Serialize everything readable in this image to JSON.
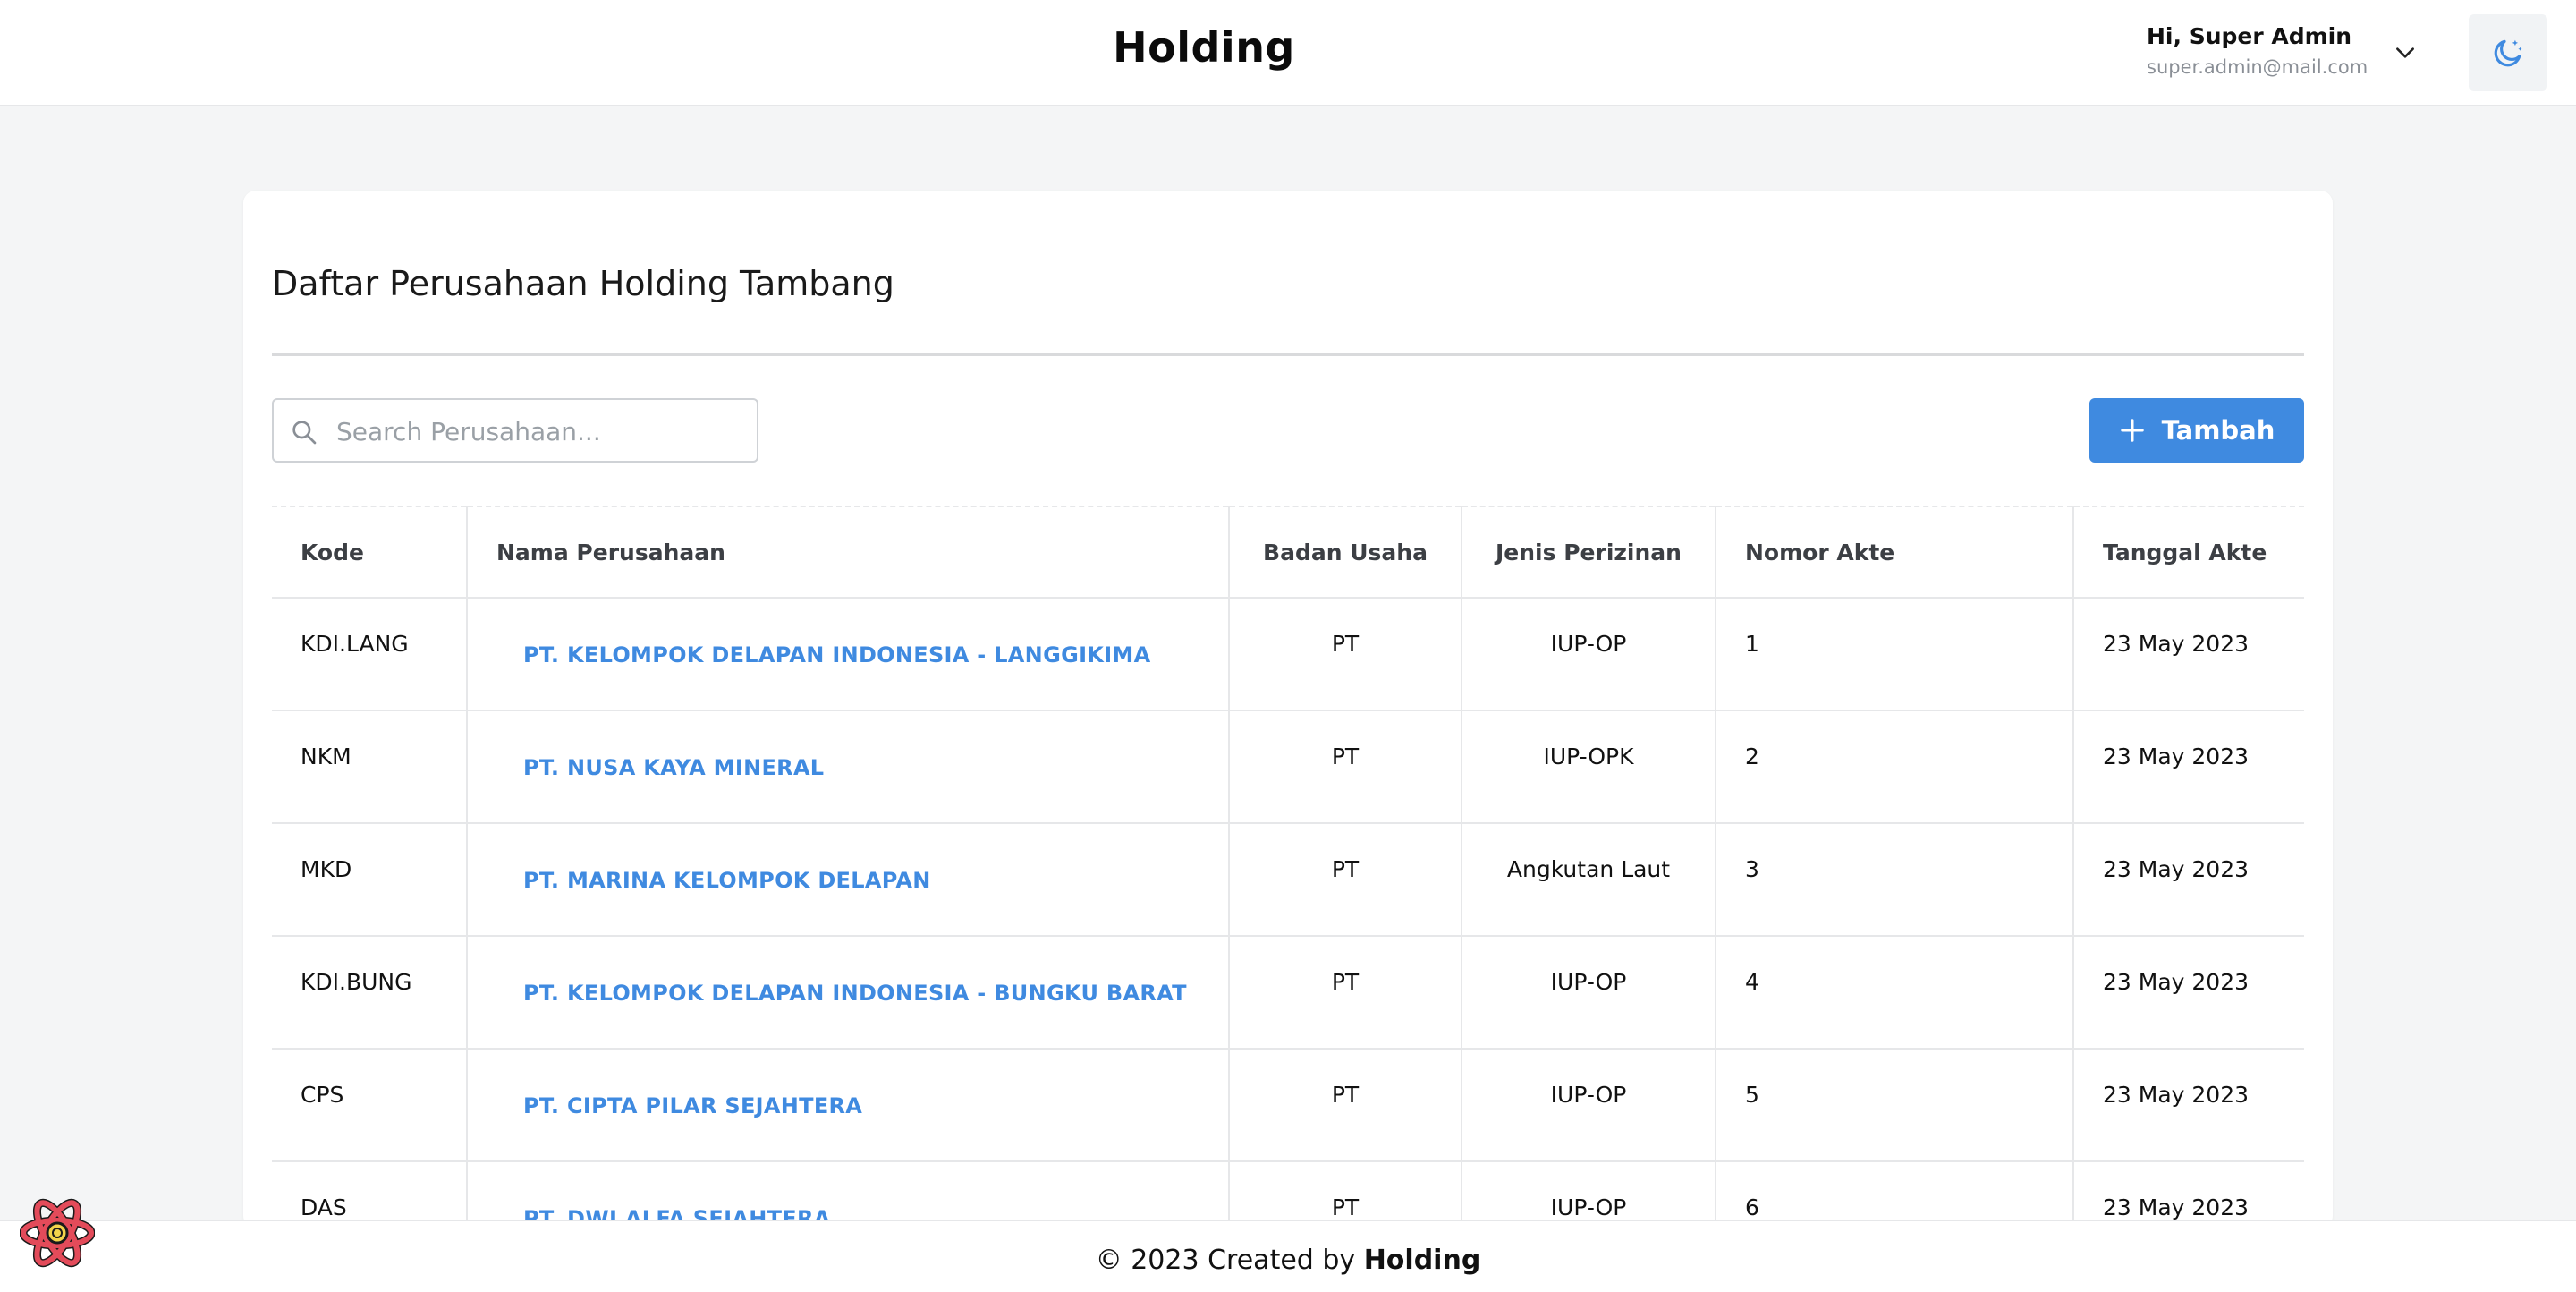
{
  "header": {
    "title": "Holding",
    "user_greeting": "Hi, Super Admin",
    "user_email": "super.admin@mail.com"
  },
  "card": {
    "title": "Daftar Perusahaan Holding Tambang",
    "search_placeholder": "Search Perusahaan...",
    "add_label": "Tambah"
  },
  "table": {
    "headers": [
      "Kode",
      "Nama Perusahaan",
      "Badan Usaha",
      "Jenis Perizinan",
      "Nomor Akte",
      "Tanggal Akte"
    ],
    "rows": [
      {
        "kode": "KDI.LANG",
        "nama": "PT. KELOMPOK DELAPAN INDONESIA - LANGGIKIMA",
        "badan": "PT",
        "jenis": "IUP-OP",
        "nomor": "1",
        "tanggal": "23 May 2023"
      },
      {
        "kode": "NKM",
        "nama": "PT. NUSA KAYA MINERAL",
        "badan": "PT",
        "jenis": "IUP-OPK",
        "nomor": "2",
        "tanggal": "23 May 2023"
      },
      {
        "kode": "MKD",
        "nama": "PT. MARINA KELOMPOK DELAPAN",
        "badan": "PT",
        "jenis": "Angkutan Laut",
        "nomor": "3",
        "tanggal": "23 May 2023"
      },
      {
        "kode": "KDI.BUNG",
        "nama": "PT. KELOMPOK DELAPAN INDONESIA - BUNGKU BARAT",
        "badan": "PT",
        "jenis": "IUP-OP",
        "nomor": "4",
        "tanggal": "23 May 2023"
      },
      {
        "kode": "CPS",
        "nama": "PT. CIPTA PILAR SEJAHTERA",
        "badan": "PT",
        "jenis": "IUP-OP",
        "nomor": "5",
        "tanggal": "23 May 2023"
      },
      {
        "kode": "DAS",
        "nama": "PT. DWI ALFA SEJAHTERA",
        "badan": "PT",
        "jenis": "IUP-OP",
        "nomor": "6",
        "tanggal": "23 May 2023"
      }
    ]
  },
  "footer": {
    "prefix": "© 2023 Created by",
    "brand": "Holding"
  },
  "colors": {
    "accent": "#3f8ae0",
    "background": "#f4f5f6"
  }
}
